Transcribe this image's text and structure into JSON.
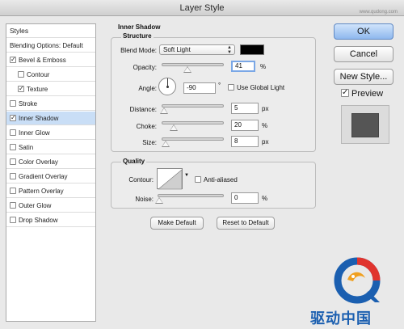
{
  "window": {
    "title": "Layer Style",
    "watermark": "www.qudong.com"
  },
  "styles_panel": {
    "items": [
      {
        "label": "Styles",
        "checkbox": false,
        "checked": false,
        "indent": false,
        "selected": false
      },
      {
        "label": "Blending Options: Default",
        "checkbox": false,
        "checked": false,
        "indent": false,
        "selected": false
      },
      {
        "label": "Bevel & Emboss",
        "checkbox": true,
        "checked": true,
        "indent": false,
        "selected": false
      },
      {
        "label": "Contour",
        "checkbox": true,
        "checked": false,
        "indent": true,
        "selected": false
      },
      {
        "label": "Texture",
        "checkbox": true,
        "checked": true,
        "indent": true,
        "selected": false
      },
      {
        "label": "Stroke",
        "checkbox": true,
        "checked": false,
        "indent": false,
        "selected": false
      },
      {
        "label": "Inner Shadow",
        "checkbox": true,
        "checked": true,
        "indent": false,
        "selected": true
      },
      {
        "label": "Inner Glow",
        "checkbox": true,
        "checked": false,
        "indent": false,
        "selected": false
      },
      {
        "label": "Satin",
        "checkbox": true,
        "checked": false,
        "indent": false,
        "selected": false
      },
      {
        "label": "Color Overlay",
        "checkbox": true,
        "checked": false,
        "indent": false,
        "selected": false
      },
      {
        "label": "Gradient Overlay",
        "checkbox": true,
        "checked": false,
        "indent": false,
        "selected": false
      },
      {
        "label": "Pattern Overlay",
        "checkbox": true,
        "checked": false,
        "indent": false,
        "selected": false
      },
      {
        "label": "Outer Glow",
        "checkbox": true,
        "checked": false,
        "indent": false,
        "selected": false
      },
      {
        "label": "Drop Shadow",
        "checkbox": true,
        "checked": false,
        "indent": false,
        "selected": false
      }
    ]
  },
  "inner_shadow": {
    "section_title": "Inner Shadow",
    "structure": {
      "title": "Structure",
      "blend_mode_label": "Blend Mode:",
      "blend_mode_value": "Soft Light",
      "shadow_color": "#000000",
      "opacity_label": "Opacity:",
      "opacity_value": "41",
      "opacity_unit": "%",
      "opacity_fraction": 0.41,
      "angle_label": "Angle:",
      "angle_value": "-90",
      "angle_unit": "°",
      "use_global_light_label": "Use Global Light",
      "use_global_light_checked": false,
      "distance_label": "Distance:",
      "distance_value": "5",
      "distance_unit": "px",
      "choke_label": "Choke:",
      "choke_value": "20",
      "choke_unit": "%",
      "size_label": "Size:",
      "size_value": "8",
      "size_unit": "px"
    },
    "quality": {
      "title": "Quality",
      "contour_label": "Contour:",
      "anti_aliased_label": "Anti-aliased",
      "anti_aliased_checked": false,
      "noise_label": "Noise:",
      "noise_value": "0",
      "noise_unit": "%"
    },
    "make_default_label": "Make Default",
    "reset_default_label": "Reset to Default"
  },
  "buttons": {
    "ok_label": "OK",
    "cancel_label": "Cancel",
    "new_style_label": "New Style...",
    "preview_label": "Preview",
    "preview_checked": true
  },
  "logo": {
    "text": "驱动中国"
  }
}
